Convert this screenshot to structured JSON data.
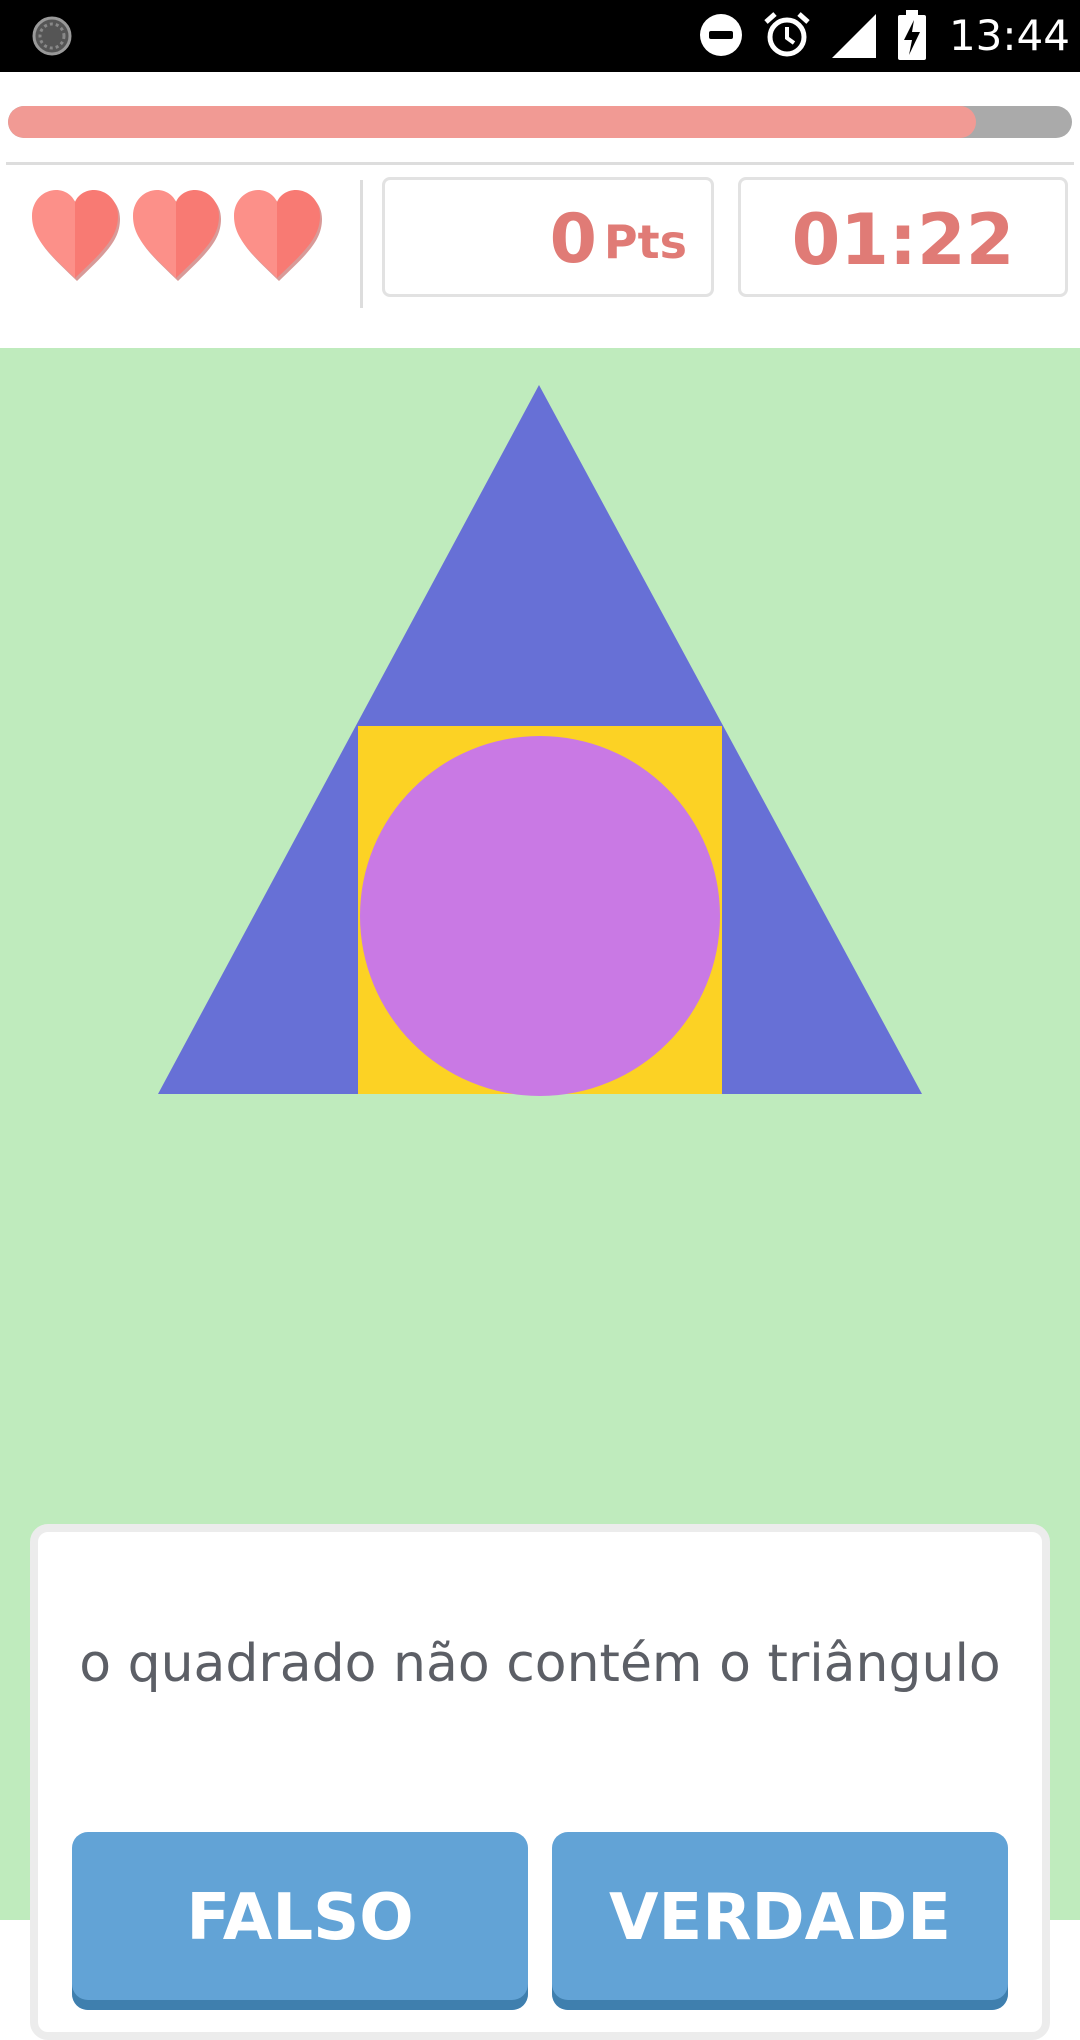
{
  "status_bar": {
    "time": "13:44",
    "icons": [
      "loading-notification-icon",
      "do-not-disturb-icon",
      "alarm-clock-icon",
      "cell-signal-icon",
      "battery-charging-icon"
    ]
  },
  "progress": {
    "fraction": 0.91,
    "fill_color": "#f19a94",
    "track_color": "#aaaaaa"
  },
  "hud": {
    "lives": 3,
    "heart_icon": "heart-icon",
    "score": "0",
    "score_unit": "Pts",
    "timer": "01:22",
    "accent_color": "#e07b76"
  },
  "figure": {
    "shapes": [
      {
        "shape": "triangle",
        "color": "#6770d6"
      },
      {
        "shape": "square",
        "color": "#fcd224"
      },
      {
        "shape": "circle",
        "color": "#c979e4"
      }
    ],
    "background": "#bfebbd"
  },
  "question": {
    "statement": "o quadrado não contém o triângulo"
  },
  "answers": {
    "false_label": "FALSO",
    "true_label": "VERDADE",
    "button_color": "#62a3d6"
  }
}
